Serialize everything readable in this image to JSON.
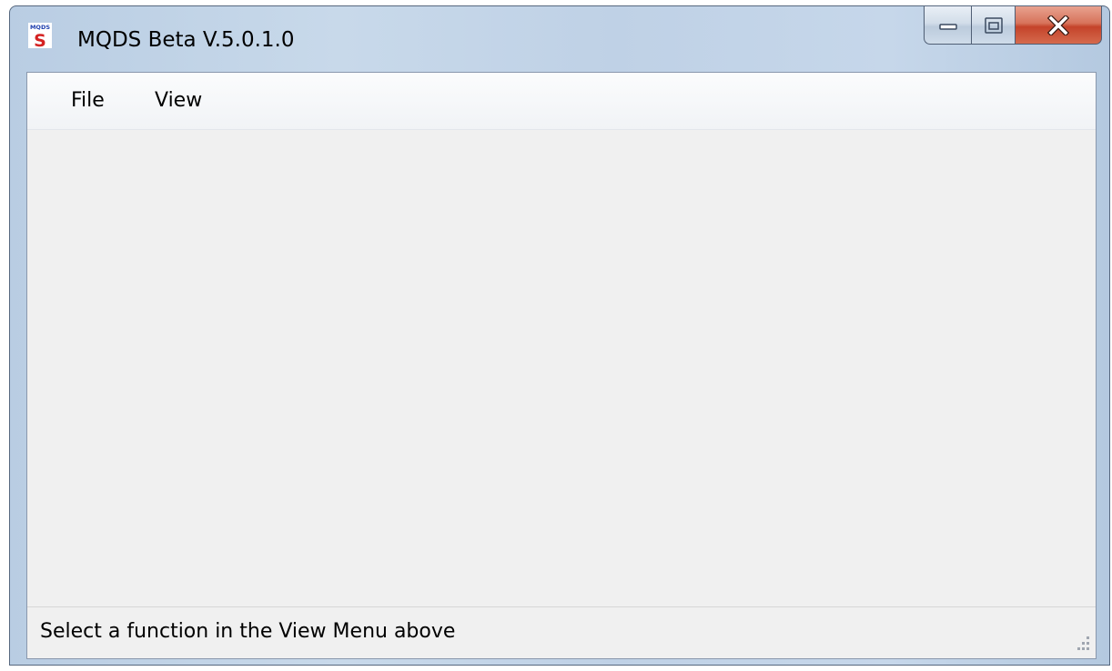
{
  "window": {
    "title": "MQDS Beta V.5.0.1.0",
    "icon_label": "MQDS",
    "icon_letter": "S"
  },
  "caption": {
    "minimize": "minimize-icon",
    "maximize": "maximize-icon",
    "close": "close-icon"
  },
  "menubar": {
    "items": [
      {
        "label": "File"
      },
      {
        "label": "View"
      }
    ]
  },
  "statusbar": {
    "text": "Select a function in the View Menu above"
  },
  "colors": {
    "client_bg": "#f0f0f0",
    "close_red": "#c4432a",
    "frame_blue": "#bfd1e6"
  }
}
